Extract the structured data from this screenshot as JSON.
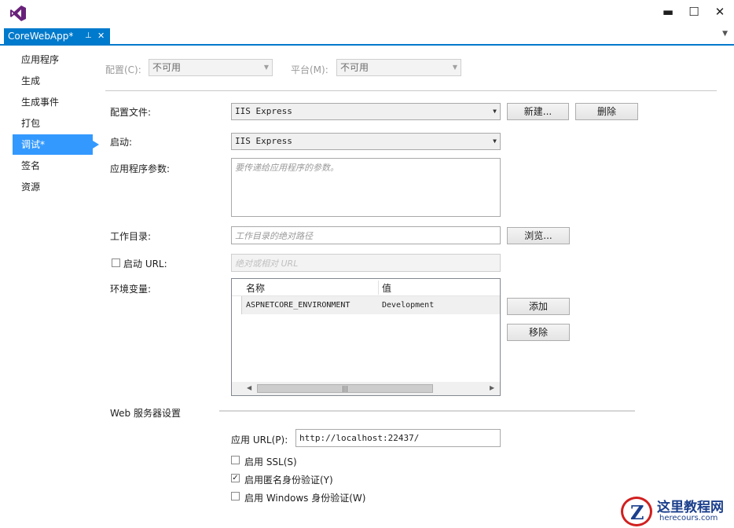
{
  "window": {
    "minimize_glyph": "▬",
    "maximize_glyph": "☐",
    "close_glyph": "✕"
  },
  "tab": {
    "title": "CoreWebApp*",
    "pin_glyph": "⊥",
    "close_glyph": "✕"
  },
  "nav": {
    "items": [
      {
        "label": "应用程序"
      },
      {
        "label": "生成"
      },
      {
        "label": "生成事件"
      },
      {
        "label": "打包"
      },
      {
        "label": "调试*"
      },
      {
        "label": "签名"
      },
      {
        "label": "资源"
      }
    ],
    "active_index": 4
  },
  "config": {
    "config_label": "配置(C):",
    "config_value": "不可用",
    "platform_label": "平台(M):",
    "platform_value": "不可用"
  },
  "profile": {
    "label": "配置文件:",
    "value": "IIS Express",
    "new_button": "新建...",
    "delete_button": "删除"
  },
  "launch": {
    "label": "启动:",
    "value": "IIS Express"
  },
  "app_args": {
    "label": "应用程序参数:",
    "placeholder": "要传递给应用程序的参数。"
  },
  "working_dir": {
    "label": "工作目录:",
    "placeholder": "工作目录的绝对路径",
    "browse_button": "浏览..."
  },
  "launch_url": {
    "label": "启动 URL:",
    "checked": false,
    "placeholder": "绝对或相对 URL"
  },
  "env": {
    "label": "环境变量:",
    "columns": [
      "名称",
      "值"
    ],
    "rows": [
      {
        "name": "ASPNETCORE_ENVIRONMENT",
        "value": "Development"
      }
    ],
    "add_button": "添加",
    "remove_button": "移除",
    "scroll_grip": "|||"
  },
  "web_server": {
    "section_label": "Web 服务器设置",
    "app_url_label": "应用 URL(P):",
    "app_url_value": "http://localhost:22437/",
    "ssl_label": "启用 SSL(S)",
    "ssl_checked": false,
    "anon_label": "启用匿名身份验证(Y)",
    "anon_checked": true,
    "windows_label": "启用 Windows 身份验证(W)",
    "windows_checked": false
  },
  "watermark": {
    "text": "这里教程网",
    "url": "herecours.com",
    "logo_letter": "Z"
  },
  "colors": {
    "accent": "#007acc",
    "nav_active": "#3399ff"
  }
}
